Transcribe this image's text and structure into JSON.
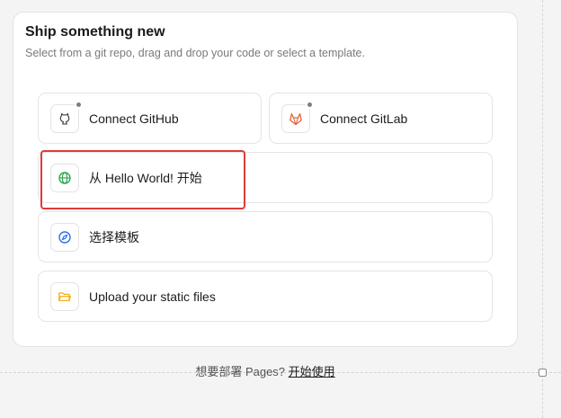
{
  "header": {
    "title": "Ship something new",
    "subtitle": "Select from a git repo, drag and drop your code or select a template."
  },
  "options": {
    "github": {
      "label": "Connect GitHub",
      "icon": "github-icon"
    },
    "gitlab": {
      "label": "Connect GitLab",
      "icon": "gitlab-icon"
    },
    "hello_world": {
      "label": "从 Hello World! 开始",
      "icon": "globe-icon"
    },
    "template": {
      "label": "选择模板",
      "icon": "compass-icon"
    },
    "upload": {
      "label": "Upload your static files",
      "icon": "folder-icon"
    }
  },
  "footer": {
    "prompt": "想要部署 Pages?",
    "link": "开始使用"
  },
  "colors": {
    "highlight": "#e03a3a",
    "globe": "#2fa84f",
    "compass": "#2f6fe4",
    "folder": "#f2b01e",
    "gitlab": "#e8623a"
  }
}
